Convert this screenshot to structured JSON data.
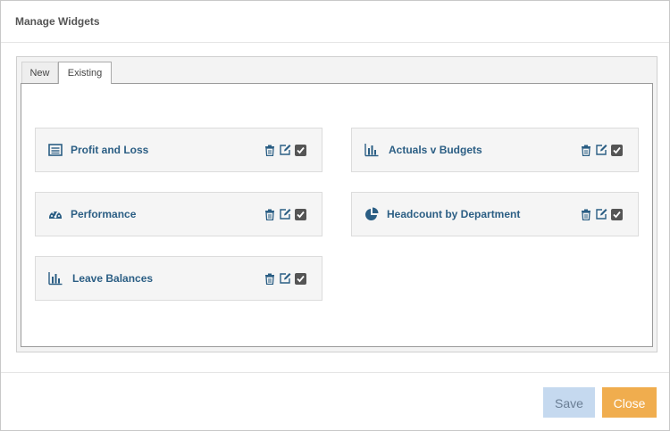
{
  "modal": {
    "title": "Manage Widgets"
  },
  "tabs": [
    {
      "label": "New",
      "active": false
    },
    {
      "label": "Existing",
      "active": true
    }
  ],
  "widgets": [
    {
      "label": "Profit and Loss",
      "icon": "list-alt-icon"
    },
    {
      "label": "Actuals v Budgets",
      "icon": "bar-chart-icon"
    },
    {
      "label": "Performance",
      "icon": "dashboard-gauge-icon"
    },
    {
      "label": "Headcount by Department",
      "icon": "pie-chart-icon"
    },
    {
      "label": "Leave Balances",
      "icon": "bar-chart-icon"
    }
  ],
  "footer": {
    "save_label": "Save",
    "close_label": "Close"
  },
  "colors": {
    "widget_label": "#2b5e84",
    "save_button": "#c5d9ef",
    "close_button": "#f0ad4e"
  }
}
